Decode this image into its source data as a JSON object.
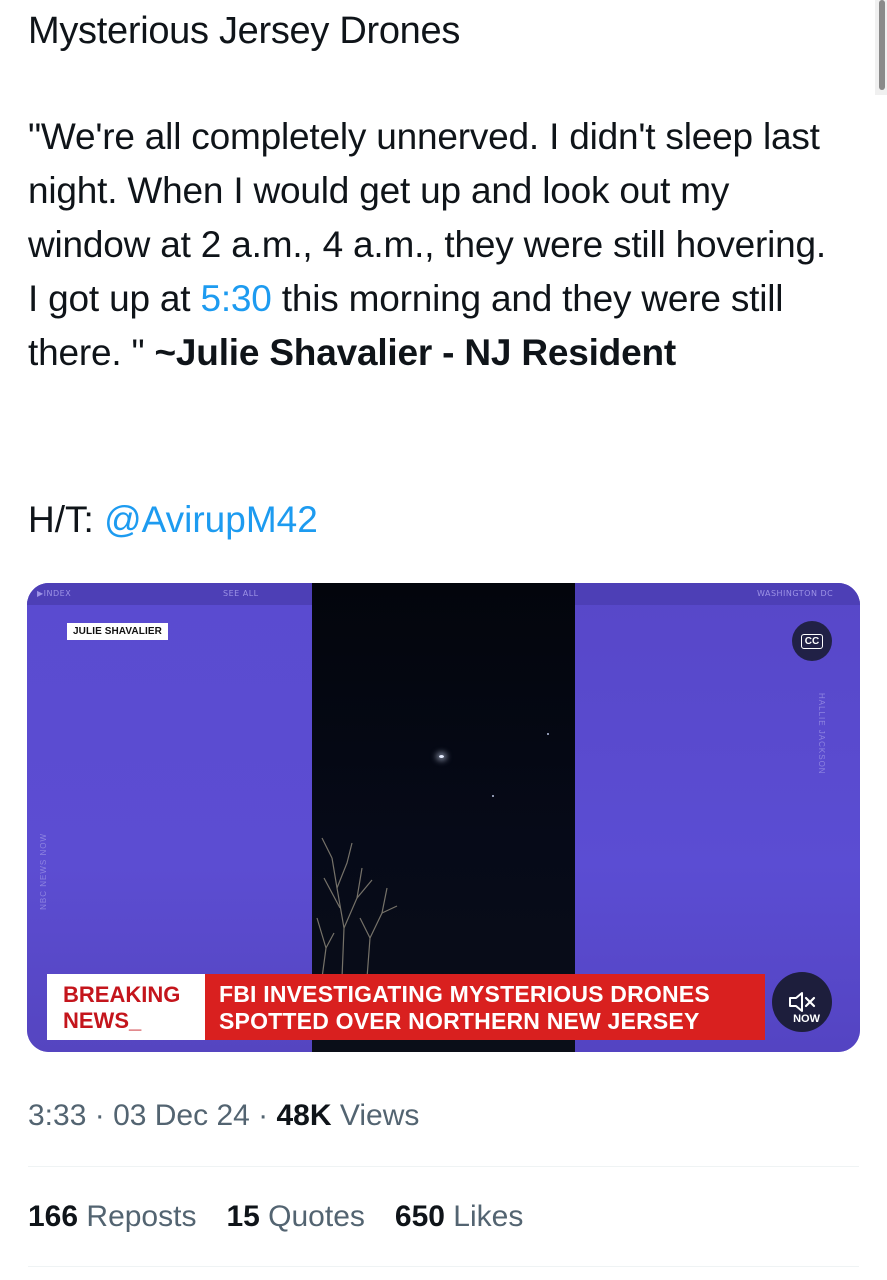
{
  "header": {
    "title": "Mysterious Jersey Drones"
  },
  "tweet": {
    "text_part1": "\"We're all completely unnerved. I didn't sleep last night. When I would get up and look out my window at 2 a.m., 4 a.m., they were still hovering. I got up at ",
    "time_link": "5:30",
    "text_part2": " this morning and they were still there. \" ",
    "bold_suffix": "~Julie Shavalier - NJ Resident",
    "ht_label": "H/T: ",
    "ht_mention": "@AvirupM42"
  },
  "media": {
    "name_tag": "JULIE SHAVALIER",
    "cc_label": "CC",
    "top_left": "▶INDEX",
    "top_mid": "SEE ALL",
    "top_right": "WASHINGTON DC",
    "side_right": "HALLIE JACKSON",
    "side_left": "NBC NEWS NOW",
    "breaking_line1": "BREAKING",
    "breaking_line2": "NEWS_",
    "headline_line1": "FBI INVESTIGATING MYSTERIOUS DRONES",
    "headline_line2": "SPOTTED OVER NORTHERN NEW JERSEY",
    "now_label": "NOW",
    "mute_icon": "speaker-muted-icon"
  },
  "meta": {
    "time": "3:33",
    "sep1": " · ",
    "date": "03 Dec 24",
    "sep2": " · ",
    "views_count": "48K",
    "views_label": " Views"
  },
  "stats": {
    "reposts_count": "166",
    "reposts_label": " Reposts",
    "quotes_count": "15",
    "quotes_label": " Quotes",
    "likes_count": "650",
    "likes_label": " Likes"
  },
  "colors": {
    "link": "#1d9bf0",
    "text": "#0f1419",
    "muted": "#536471",
    "breaking_red": "#d9201f",
    "studio_purple": "#5747c4"
  }
}
